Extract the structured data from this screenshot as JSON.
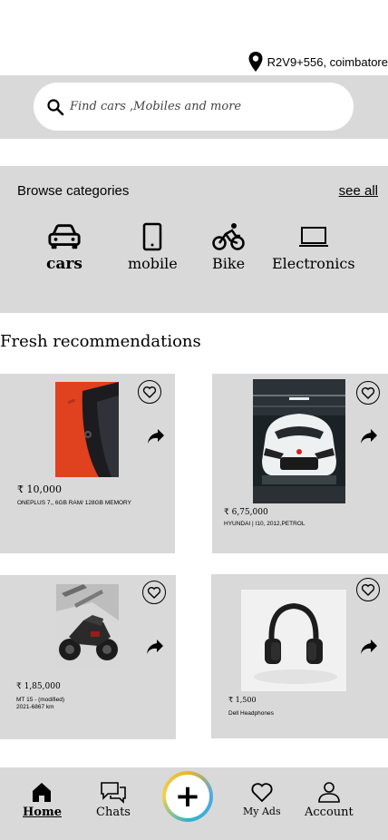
{
  "location": {
    "text": "R2V9+556, coimbatore",
    "icon": "location-pin-icon"
  },
  "search": {
    "placeholder": "Find cars ,Mobiles and more",
    "icon": "search-icon"
  },
  "categories": {
    "title": "Browse categories",
    "see_all": "see all",
    "items": [
      {
        "label": "cars",
        "icon": "car-icon"
      },
      {
        "label": "mobile",
        "icon": "mobile-icon"
      },
      {
        "label": "Bike",
        "icon": "bike-icon"
      },
      {
        "label": "Electronics",
        "icon": "laptop-icon"
      }
    ]
  },
  "fresh": {
    "title": "Fresh recommendations",
    "listings": [
      {
        "price": "10,000",
        "desc_lines": [
          "ONEPLUS 7,, 6GB RAM/ 128GB MEMORY"
        ],
        "image": "red-phone"
      },
      {
        "price": "6,75,000",
        "desc_lines": [
          "HYUNDAI | I10, 2012,PETROL"
        ],
        "image": "white-car"
      },
      {
        "price": "1,85,000",
        "desc_lines": [
          "MT 15 - (modified)",
          "2021-6867 km"
        ],
        "image": "dark-bike"
      },
      {
        "price": "1,500",
        "desc_lines": [
          "Dell Headphones"
        ],
        "image": "headphones"
      }
    ]
  },
  "nav": {
    "items": [
      {
        "label": "Home",
        "icon": "home-icon"
      },
      {
        "label": "Chats",
        "icon": "chat-icon"
      },
      {
        "label": "My Ads",
        "icon": "heart-icon"
      },
      {
        "label": "Account",
        "icon": "person-icon"
      }
    ],
    "sell_icon": "plus-icon",
    "sell_symbol": "+"
  },
  "colors": {
    "panel": "#d9d9d9",
    "sell_ring": [
      "#e8b82c",
      "#4ea7e8",
      "#2fb5c9",
      "#f2d04b"
    ]
  }
}
